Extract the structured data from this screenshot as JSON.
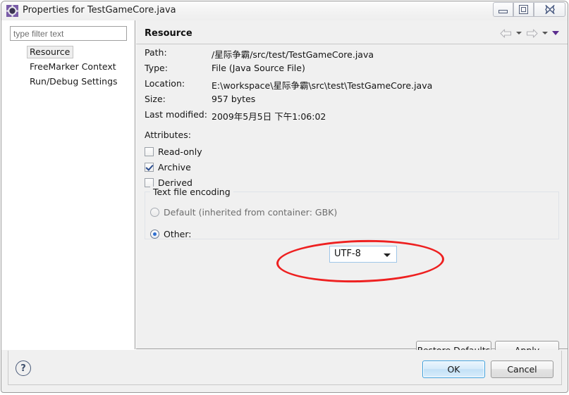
{
  "window": {
    "title": "Properties for TestGameCore.java",
    "icon": "properties-gear-icon",
    "controls": {
      "minimize": "minimize-icon",
      "maximize": "restore-icon",
      "close": "close-icon"
    }
  },
  "sidebar": {
    "filter": {
      "placeholder": "type filter text",
      "value": ""
    },
    "items": [
      {
        "label": "Resource",
        "selected": true
      },
      {
        "label": "FreeMarker Context",
        "selected": false
      },
      {
        "label": "Run/Debug Settings",
        "selected": false
      }
    ]
  },
  "page": {
    "title": "Resource",
    "nav": {
      "back": "back-arrow-icon",
      "back_menu": "chevron-down-icon",
      "forward": "forward-arrow-icon",
      "forward_menu": "chevron-down-icon",
      "view_menu": "view-menu-chevron-icon"
    },
    "properties": [
      {
        "label": "Path:",
        "value": "/星际争霸/src/test/TestGameCore.java"
      },
      {
        "label": "Type:",
        "value": "File  (Java Source File)"
      },
      {
        "label": "Location:",
        "value": "E:\\workspace\\星际争霸\\src\\test\\TestGameCore.java"
      },
      {
        "label": "Size:",
        "value": "957  bytes"
      },
      {
        "label": "Last modified:",
        "value": "2009年5月5日 下午1:06:02"
      }
    ],
    "attributes": {
      "label": "Attributes:",
      "checkboxes": [
        {
          "label": "Read-only",
          "checked": false
        },
        {
          "label": "Archive",
          "checked": true
        },
        {
          "label": "Derived",
          "checked": false
        }
      ]
    },
    "encoding_group": {
      "title": "Text file encoding",
      "options": [
        {
          "label": "Default (inherited from container: GBK)",
          "selected": false,
          "enabled": false
        },
        {
          "label": "Other:",
          "selected": true,
          "enabled": true
        }
      ],
      "combo": {
        "value": "UTF-8",
        "arrow": "combo-dropdown-arrow-icon"
      }
    },
    "buttons": {
      "restore_defaults": "Restore Defaults",
      "apply": "Apply"
    }
  },
  "footer": {
    "help": "?",
    "ok": "OK",
    "cancel": "Cancel"
  },
  "annotation": {
    "shape": "red-ellipse-highlight",
    "color": "#ee2020"
  }
}
